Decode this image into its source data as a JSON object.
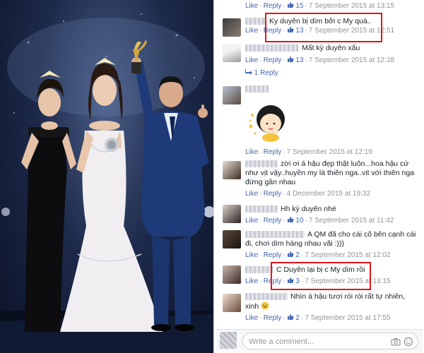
{
  "photo": {
    "description_icon": "award-ceremony-photo"
  },
  "ui": {
    "like": "Like",
    "reply": "Reply",
    "sep": "·",
    "colors": {
      "link": "#4267b2",
      "meta": "#90949c",
      "highlight": "#e2141b"
    }
  },
  "comments": [
    {
      "likes": "15",
      "time": "7 September 2015 at 13:15",
      "text": ""
    },
    {
      "text": "Ky duyên bị dìm bởi c My quá..",
      "likes": "13",
      "time": "7 September 2015 at 12:51"
    },
    {
      "text": "Mất kỳ duyên xấu",
      "likes": "13",
      "time": "7 September 2015 at 12:28",
      "replies": "1 Reply"
    },
    {
      "text": "",
      "sticker": "girl-thinking-sticker",
      "time": "7 September 2015 at 12:19"
    },
    {
      "text": "zời ơi á hậu đẹp thật luôn...hoa hậu cứ như vịt vậy..huyền my là thiên nga..vịt với thiên nga đứng gần nhau",
      "time": "4 December 2015 at 19:32"
    },
    {
      "text": "Hh kỳ duyên nhé",
      "likes": "10",
      "time": "7 September 2015 at 11:42"
    },
    {
      "text": "A QM đã cho cái cô bên cạnh cái đi, chơi dìm hàng nhau vãi :)))",
      "likes": "2",
      "time": "7 September 2015 at 12:02"
    },
    {
      "text": "C Duyên lại bị c My dìm rồi",
      "likes": "3",
      "time": "7 September 2015 at 13:15"
    },
    {
      "text": "Nhìn á hậu tươi rói rói rất tự nhiên, xinh",
      "likes": "2",
      "time": "7 September 2015 at 17:55"
    }
  ],
  "composer": {
    "placeholder": "Write a comment..."
  }
}
